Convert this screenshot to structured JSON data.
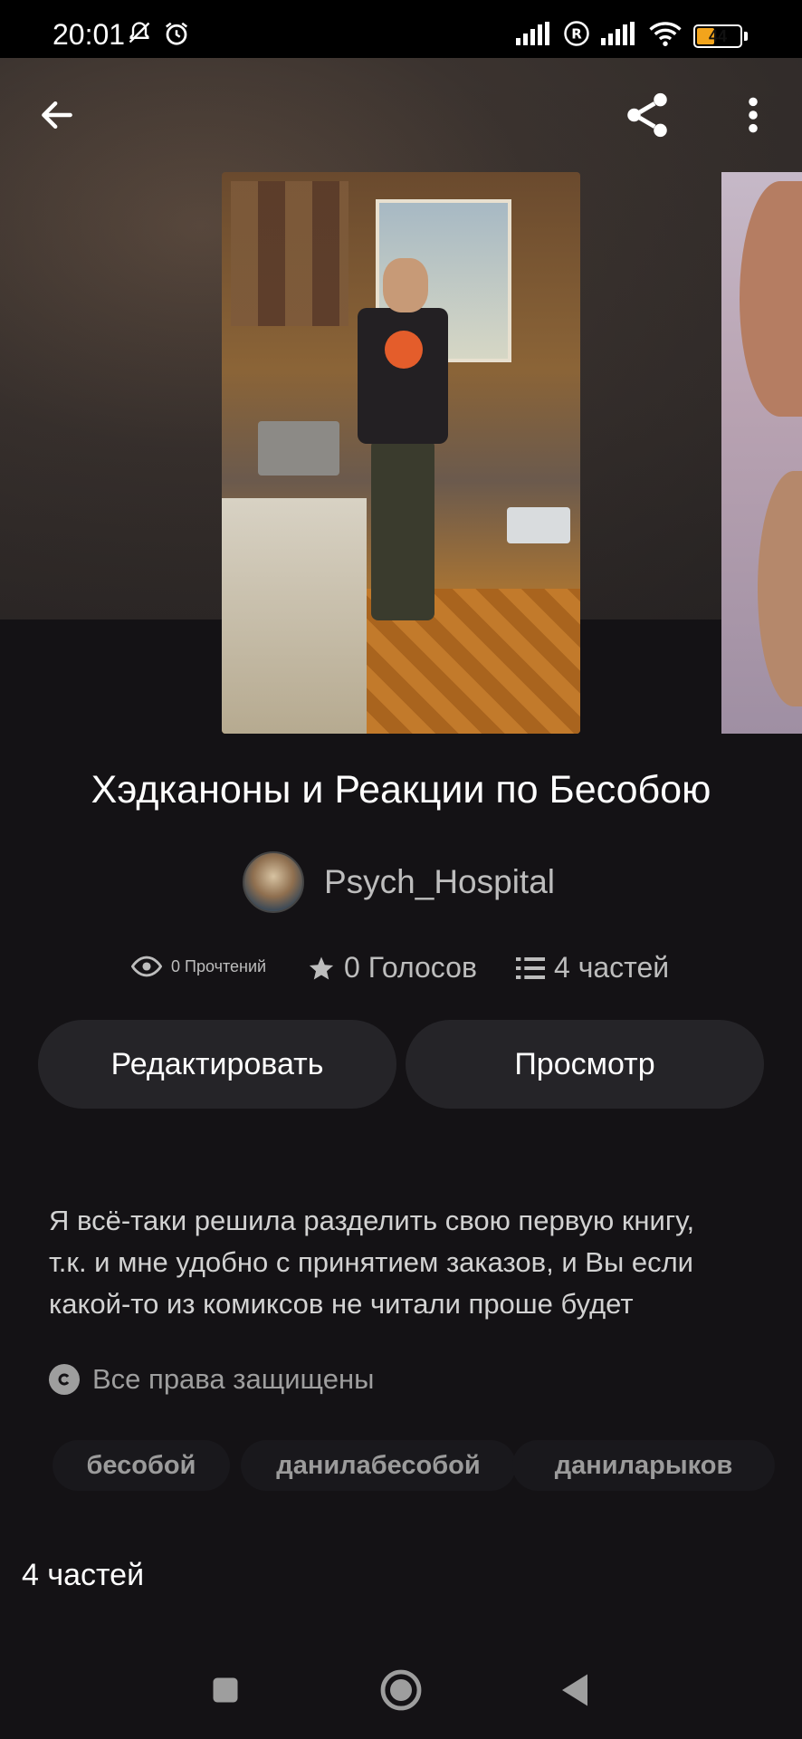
{
  "status_bar": {
    "time": "20:01",
    "battery": "44",
    "icons": [
      "bell-off-icon",
      "alarm-icon",
      "signal-icon",
      "roaming-icon",
      "signal-icon",
      "wifi-icon",
      "battery-icon"
    ]
  },
  "header": {
    "back_icon": "arrow-left-icon",
    "share_icon": "share-icon",
    "more_icon": "more-vertical-icon"
  },
  "story": {
    "title": "Хэдканоны и Реакции по Бесобою",
    "author": "Psych_Hospital",
    "stats": {
      "reads": "0 Прочтений",
      "votes": "0 Голосов",
      "parts": "4 частей"
    },
    "buttons": {
      "edit": "Редактировать",
      "view": "Просмотр"
    },
    "description_lines": [
      "Я всё-таки решила разделить свою первую книгу,",
      "т.к. и мне удобно с принятием заказов, и Вы если",
      "какой-то из комиксов не читали проше будет"
    ],
    "copyright": "Все права защищены",
    "tags": [
      "бесобой",
      "данилабесобой",
      "даниларыков"
    ],
    "parts_heading": "4 частей"
  },
  "nav": {
    "icons": [
      "recents-square-icon",
      "home-circle-icon",
      "back-triangle-icon"
    ]
  },
  "colors": {
    "background": "#141215",
    "button_bg": "#252428",
    "tag_bg": "#19181c",
    "battery_accent": "#f2a41c"
  }
}
